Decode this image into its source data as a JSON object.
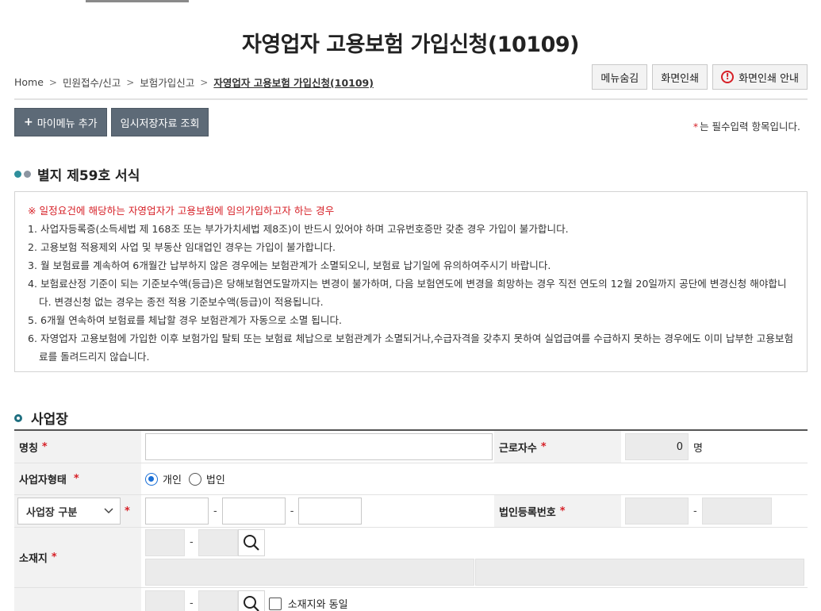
{
  "page": {
    "title": "자영업자 고용보험 가입신청(10109)"
  },
  "breadcrumb": [
    "Home",
    "민원접수/신고",
    "보험가입신고",
    "자영업자 고용보험 가입신청(10109)"
  ],
  "top_buttons": {
    "hide_menu": "메뉴숨김",
    "print": "화면인쇄",
    "print_guide": "화면인쇄 안내",
    "print_guide_icon": "!"
  },
  "actions": {
    "add_my_menu": "마이메뉴 추가",
    "add_my_menu_icon": "+",
    "temp_saved": "임시저장자료 조회"
  },
  "required_note": {
    "star": "*",
    "text": "는 필수입력 항목입니다."
  },
  "form_section": {
    "title": "별지 제59호 서식"
  },
  "notice": {
    "warning": "※ 일정요건에 해당하는 자영업자가 고용보험에 임의가입하고자 하는 경우",
    "items": [
      "1. 사업자등록증(소득세법 제 168조 또는 부가가치세법 제8조)이 반드시 있어야 하며 고유번호증만 갖춘 경우 가입이 불가합니다.",
      "2. 고용보험 적용제외 사업 및 부동산 임대업인 경우는 가입이 불가합니다.",
      "3. 월 보험료를 계속하여 6개월간 납부하지 않은 경우에는 보험관계가 소멸되오니, 보험료 납기일에 유의하여주시기 바랍니다.",
      "4. 보험료산정 기준이 되는 기준보수액(등급)은 당해보험연도말까지는 변경이 불가하며, 다음 보험연도에 변경을 희망하는 경우 직전 연도의 12월 20일까지 공단에 변경신청 해야합니다. 변경신청 없는 경우는 종전 적용 기준보수액(등급)이 적용됩니다.",
      "5. 6개월 연속하여 보험료를 체납할 경우 보험관계가 자동으로 소멸 됩니다.",
      "6. 자영업자 고용보험에 가입한 이후 보험가입 탈퇴 또는 보험료 체납으로 보험관계가 소멸되거나,수급자격을 갖추지 못하여 실업급여를 수급하지 못하는 경우에도 이미 납부한 고용보험료를 돌려드리지 않습니다."
    ]
  },
  "business_section": {
    "title": "사업장",
    "required_mark": "*",
    "labels": {
      "name": "명칭",
      "employees": "근로자수",
      "biz_type": "사업자형태",
      "corp_reg_no": "법인등록번호",
      "location": "소재지"
    },
    "employees_value": "0",
    "employees_unit": "명",
    "biz_type_options": [
      "개인",
      "법인"
    ],
    "biz_type_selected": "개인",
    "biz_division_select": "사업장 구분",
    "same_as_location": "소재지와 동일"
  },
  "icons": {
    "breadcrumb_sep": "chevron-right-icon",
    "select_arrow": "chevron-down-icon",
    "search": "search-icon",
    "warning": "exclamation-circle-icon"
  },
  "colors": {
    "required": "#d61f26",
    "action_button": "#5d6a77",
    "radio_accent": "#1a6fd6",
    "section_accent": "#1f6f80"
  }
}
